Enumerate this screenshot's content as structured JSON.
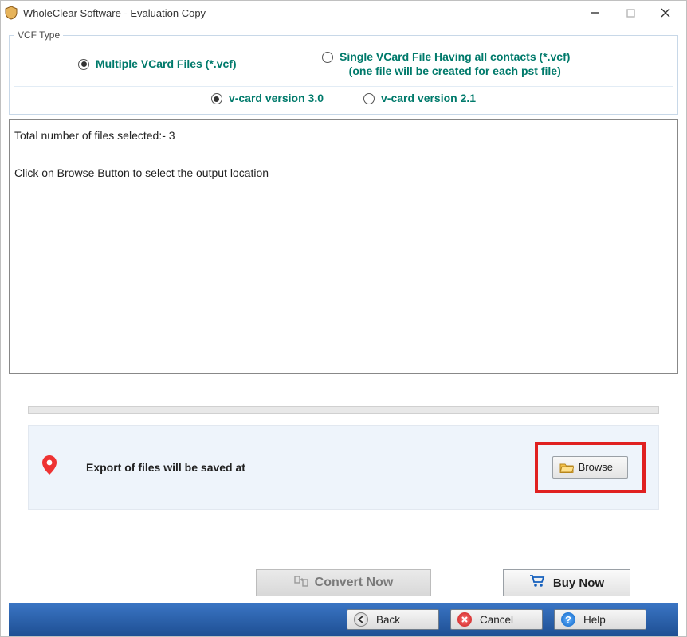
{
  "window": {
    "title": "WholeClear Software - Evaluation Copy"
  },
  "vcf_type": {
    "legend": "VCF Type",
    "multiple_label": "Multiple VCard Files (*.vcf)",
    "single_label_line1": "Single VCard File Having all contacts (*.vcf)",
    "single_label_line2": "(one file will be created for each pst file)",
    "v30_label": "v-card version 3.0",
    "v21_label": "v-card version 2.1"
  },
  "output": {
    "line1_prefix": "Total number of files selected:- ",
    "files_count": "3",
    "line2": "Click on Browse Button to select the output location"
  },
  "export": {
    "text": "Export of files will be saved at",
    "browse_label": "Browse"
  },
  "actions": {
    "convert_label": "Convert Now",
    "buy_label": "Buy Now"
  },
  "nav": {
    "back_label": "Back",
    "cancel_label": "Cancel",
    "help_label": "Help"
  }
}
